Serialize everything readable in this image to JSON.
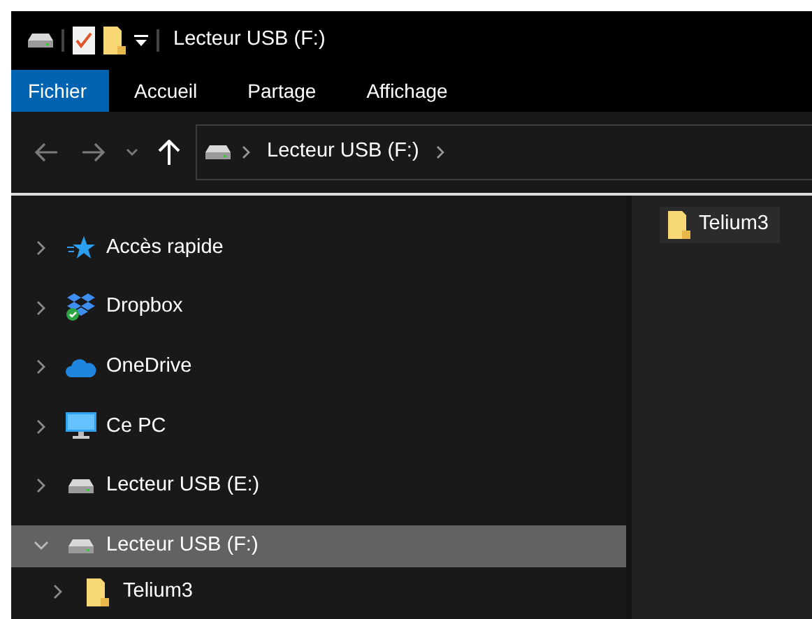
{
  "title_bar": {
    "quick_access": [
      {
        "kind": "drive"
      },
      {
        "kind": "properties"
      },
      {
        "kind": "folder"
      },
      {
        "kind": "customize"
      }
    ],
    "title": "Lecteur USB (F:)"
  },
  "ribbon_tabs": [
    {
      "label": "Fichier",
      "selected": true
    },
    {
      "label": "Accueil",
      "selected": false
    },
    {
      "label": "Partage",
      "selected": false
    },
    {
      "label": "Affichage",
      "selected": false
    }
  ],
  "navigation": {
    "back_disabled": true,
    "forward_disabled": true,
    "up_disabled": false
  },
  "address_bar": {
    "segments": [
      "Lecteur USB (F:)"
    ]
  },
  "tree": [
    {
      "label": "Accès rapide",
      "kind": "star",
      "expanded": false,
      "selected": false
    },
    {
      "label": "Dropbox",
      "kind": "dropbox",
      "expanded": false,
      "selected": false
    },
    {
      "label": "OneDrive",
      "kind": "onedrive",
      "expanded": false,
      "selected": false
    },
    {
      "label": "Ce PC",
      "kind": "pc",
      "expanded": false,
      "selected": false
    },
    {
      "label": "Lecteur USB (E:)",
      "kind": "drive",
      "expanded": false,
      "selected": false
    },
    {
      "label": "Lecteur USB (F:)",
      "kind": "drive",
      "expanded": true,
      "selected": true,
      "children": [
        {
          "label": "Telium3",
          "kind": "folder",
          "expanded": false,
          "selected": false
        }
      ]
    }
  ],
  "files": [
    {
      "name": "Telium3",
      "kind": "folder"
    }
  ]
}
